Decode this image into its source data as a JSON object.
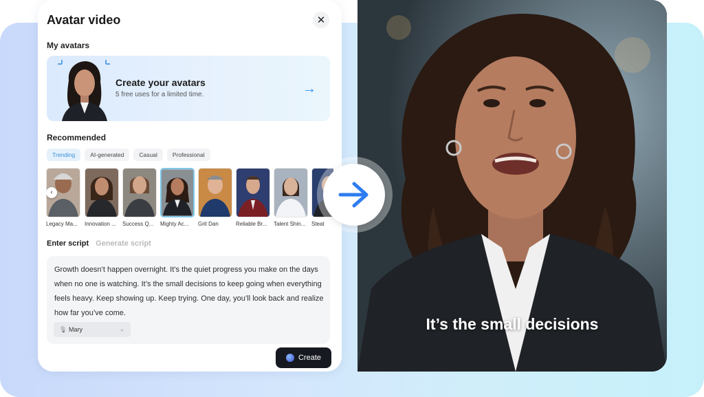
{
  "panel": {
    "title": "Avatar video",
    "close_icon": "close-icon",
    "my_avatars_label": "My avatars",
    "create_card": {
      "title": "Create your avatars",
      "subtitle": "5 free uses for a limited time.",
      "arrow_icon": "arrow-right-icon"
    },
    "recommended_label": "Recommended",
    "tabs": [
      {
        "label": "Trending",
        "active": true
      },
      {
        "label": "AI-generated",
        "active": false
      },
      {
        "label": "Casual",
        "active": false
      },
      {
        "label": "Professional",
        "active": false
      }
    ],
    "avatars": [
      {
        "name": "Legacy Ma..."
      },
      {
        "name": "Innovation ..."
      },
      {
        "name": "Success Q..."
      },
      {
        "name": "Mighty Ac...",
        "selected": true
      },
      {
        "name": "Grit Dan"
      },
      {
        "name": "Reliable Br..."
      },
      {
        "name": "Talent Shin..."
      },
      {
        "name": "Steat"
      }
    ],
    "script_tabs": {
      "active": "Enter script",
      "inactive": "Generate script"
    },
    "script_text": "Growth doesn’t happen overnight. It’s the quiet progress you make on the days when no one is watching. It’s the small decisions to keep going when everything feels heavy. Keep showing up. Keep trying. One day, you’ll look back and realize how far you’ve come.",
    "voice": {
      "name": "Mary",
      "icon": "microphone-icon"
    },
    "create_button": "Create"
  },
  "video": {
    "caption": "It’s the small decisions"
  },
  "colors": {
    "accent": "#2d8cf0",
    "button_dark": "#16191f",
    "tab_active": "#3a8fd4"
  }
}
